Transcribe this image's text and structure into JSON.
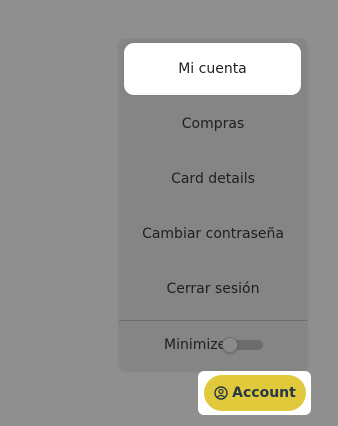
{
  "menu": {
    "items": [
      {
        "label": "Mi cuenta"
      },
      {
        "label": "Compras"
      },
      {
        "label": "Card details"
      },
      {
        "label": "Cambiar contraseña"
      },
      {
        "label": "Cerrar sesión"
      }
    ],
    "minimize_label": "Minimize"
  },
  "account_button": {
    "label": "Account",
    "icon": "user-circle-icon"
  },
  "colors": {
    "overlay": "#8f8f8f",
    "panel": "#858585",
    "button_bg": "#e0c93a",
    "button_text": "#283746",
    "active_item_bg": "#ffffff"
  }
}
